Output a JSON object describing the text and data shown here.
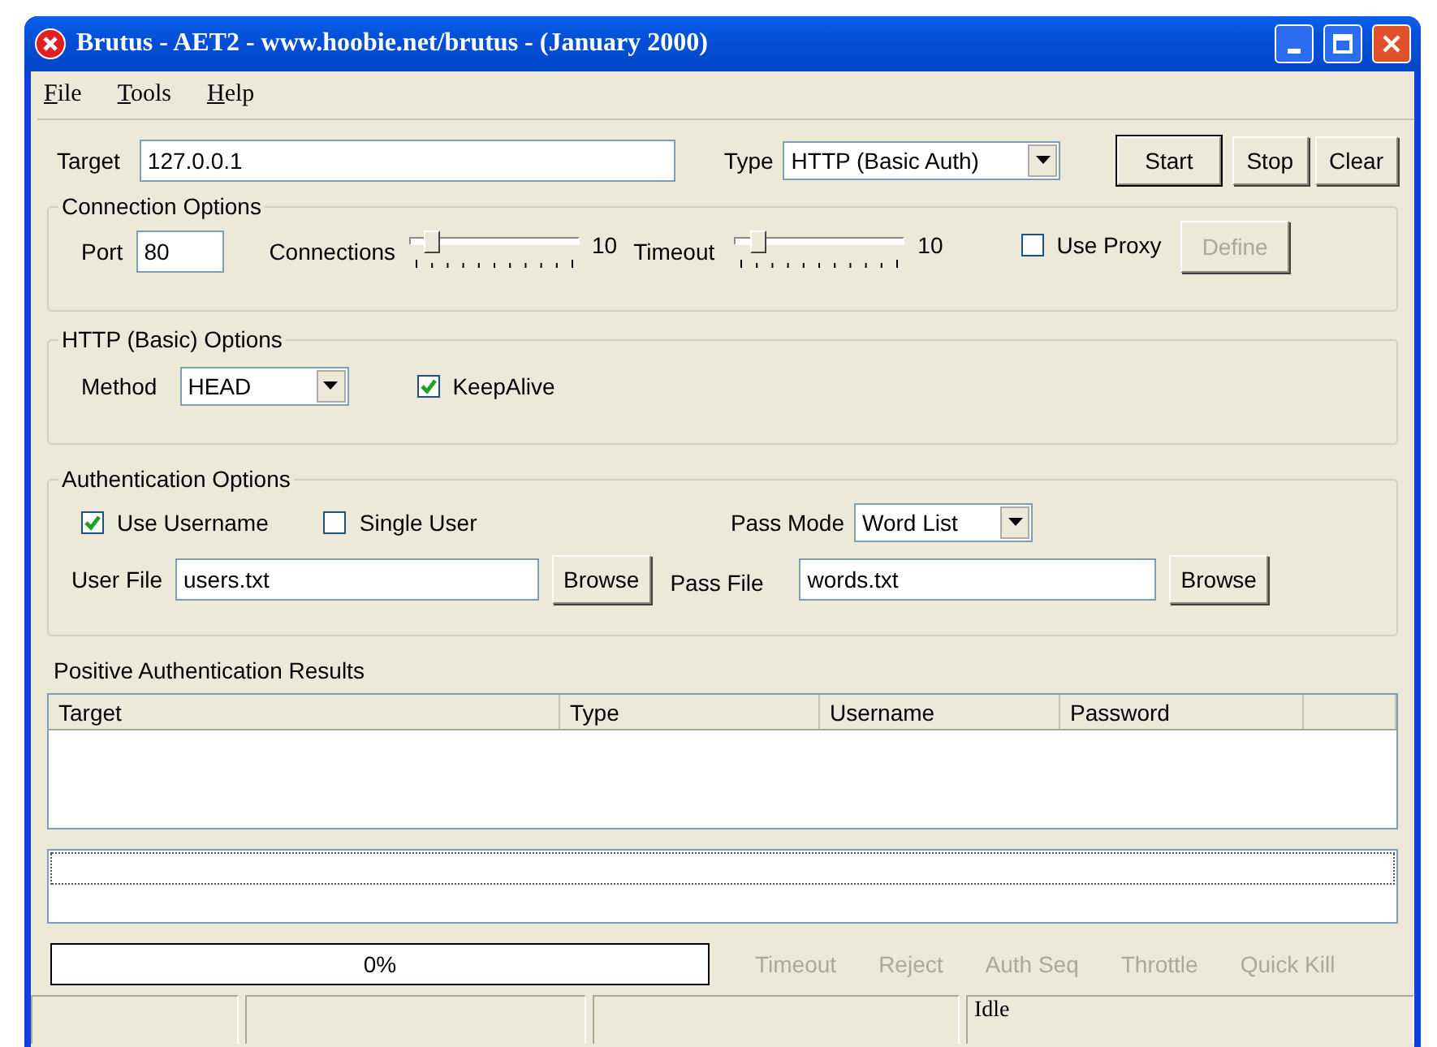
{
  "window": {
    "title": "Brutus - AET2 - www.hoobie.net/brutus - (January 2000)"
  },
  "menu": [
    {
      "label": "File"
    },
    {
      "label": "Tools"
    },
    {
      "label": "Help"
    }
  ],
  "target": {
    "label": "Target",
    "value": "127.0.0.1"
  },
  "type": {
    "label": "Type",
    "value": "HTTP (Basic Auth)"
  },
  "buttons": [
    {
      "label": "Start",
      "default": true
    },
    {
      "label": "Stop",
      "default": false
    },
    {
      "label": "Clear",
      "default": false
    }
  ],
  "connection_options": {
    "title": "Connection Options",
    "port": {
      "label": "Port",
      "value": "80"
    },
    "connections": {
      "label": "Connections",
      "level": 0.1,
      "reading": "10"
    },
    "timeout": {
      "label": "Timeout",
      "level": 0.1,
      "reading": "10"
    },
    "use_proxy": {
      "label": "Use Proxy",
      "checked": false
    },
    "define": {
      "label": "Define",
      "disabled": true
    }
  },
  "http_options": {
    "title": "HTTP (Basic) Options",
    "method": {
      "label": "Method",
      "value": "HEAD"
    },
    "keepalive": {
      "label": "KeepAlive",
      "checked": true
    }
  },
  "auth_options": {
    "title": "Authentication Options",
    "use_username": {
      "label": "Use Username",
      "checked": true
    },
    "single_user": {
      "label": "Single User",
      "checked": false
    },
    "pass_mode": {
      "label": "Pass Mode",
      "value": "Word List"
    },
    "user_file": {
      "label": "User File",
      "value": "users.txt",
      "button": "Browse"
    },
    "pass_file": {
      "label": "Pass File",
      "value": "words.txt",
      "button": "Browse"
    }
  },
  "results": {
    "title": "Positive Authentication Results",
    "columns": [
      "Target",
      "Type",
      "Username",
      "Password"
    ]
  },
  "progress": {
    "level": 0,
    "reading": "0%"
  },
  "indicators": [
    {
      "label": "Timeout",
      "disabled": true
    },
    {
      "label": "Reject",
      "disabled": true
    },
    {
      "label": "Auth Seq",
      "disabled": true
    },
    {
      "label": "Throttle",
      "disabled": true
    },
    {
      "label": "Quick Kill",
      "disabled": true
    }
  ],
  "status_bar": {
    "message": "Idle"
  }
}
